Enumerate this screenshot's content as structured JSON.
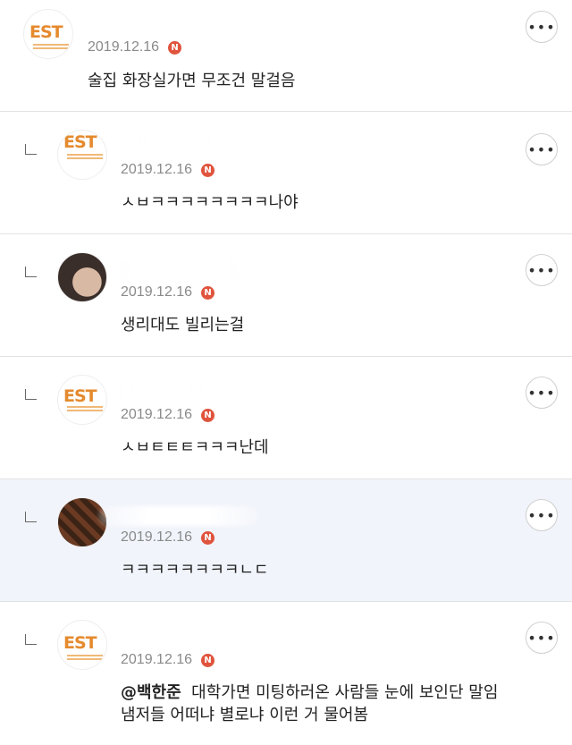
{
  "comments": [
    {
      "date": "2019.12.16",
      "badge": "N",
      "text": "술집 화장실가면 무조건 말걸음"
    },
    {
      "date": "2019.12.16",
      "badge": "N",
      "text": "ㅅㅂㅋㅋㅋㅋㅋㅋㅋㅋ나야"
    },
    {
      "date": "2019.12.16",
      "badge": "N",
      "text": "생리대도 빌리는걸"
    },
    {
      "date": "2019.12.16",
      "badge": "N",
      "text": "ㅅㅂㅌㅌㅌㅋㅋㅋ난데"
    },
    {
      "date": "2019.12.16",
      "badge": "N",
      "text": "ㅋㅋㅋㅋㅋㅋㅋㅋㄴㄷ"
    },
    {
      "date": "2019.12.16",
      "badge": "N",
      "mention": "@백한준",
      "text_line1": "대학가면 미팅하러온 사람들 눈에 보인단 말임",
      "text_line2": "냄저들 어떠냐 별로냐 이런 거 물어봄"
    }
  ],
  "avatar_logo_text": "EST",
  "more_label": "•••",
  "colors": {
    "badge": "#e0543d",
    "highlight_bg": "#f1f4fb",
    "logo": "#e58a2e"
  }
}
